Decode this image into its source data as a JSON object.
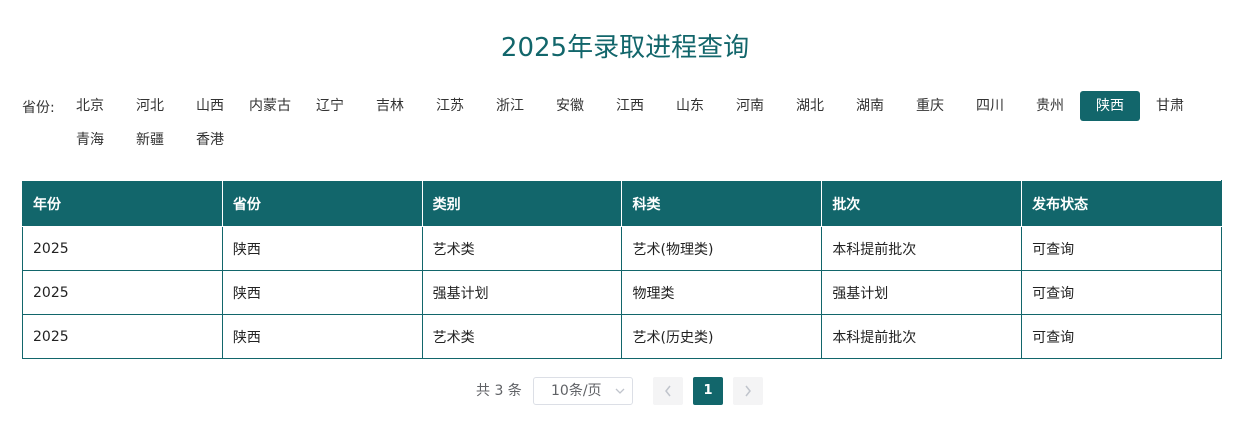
{
  "page": {
    "title": "2025年录取进程查询"
  },
  "provinces": {
    "label": "省份:",
    "selected": "陕西",
    "row1": [
      "北京",
      "河北",
      "山西",
      "内蒙古",
      "辽宁",
      "吉林",
      "江苏",
      "浙江",
      "安徽",
      "江西",
      "山东",
      "河南",
      "湖北",
      "湖南",
      "重庆",
      "四川",
      "贵州",
      "陕西",
      "甘肃"
    ],
    "row2": [
      "青海",
      "新疆",
      "香港"
    ]
  },
  "table": {
    "headers": [
      "年份",
      "省份",
      "类别",
      "科类",
      "批次",
      "发布状态"
    ],
    "rows": [
      [
        "2025",
        "陕西",
        "艺术类",
        "艺术(物理类)",
        "本科提前批次",
        "可查询"
      ],
      [
        "2025",
        "陕西",
        "强基计划",
        "物理类",
        "强基计划",
        "可查询"
      ],
      [
        "2025",
        "陕西",
        "艺术类",
        "艺术(历史类)",
        "本科提前批次",
        "可查询"
      ]
    ]
  },
  "pagination": {
    "total_text": "共 3 条",
    "page_size": "10条/页",
    "current_page": "1",
    "prev_icon": "chevron-left-icon",
    "next_icon": "chevron-right-icon",
    "dropdown_icon": "chevron-down-icon"
  },
  "colors": {
    "accent": "#12666b"
  }
}
